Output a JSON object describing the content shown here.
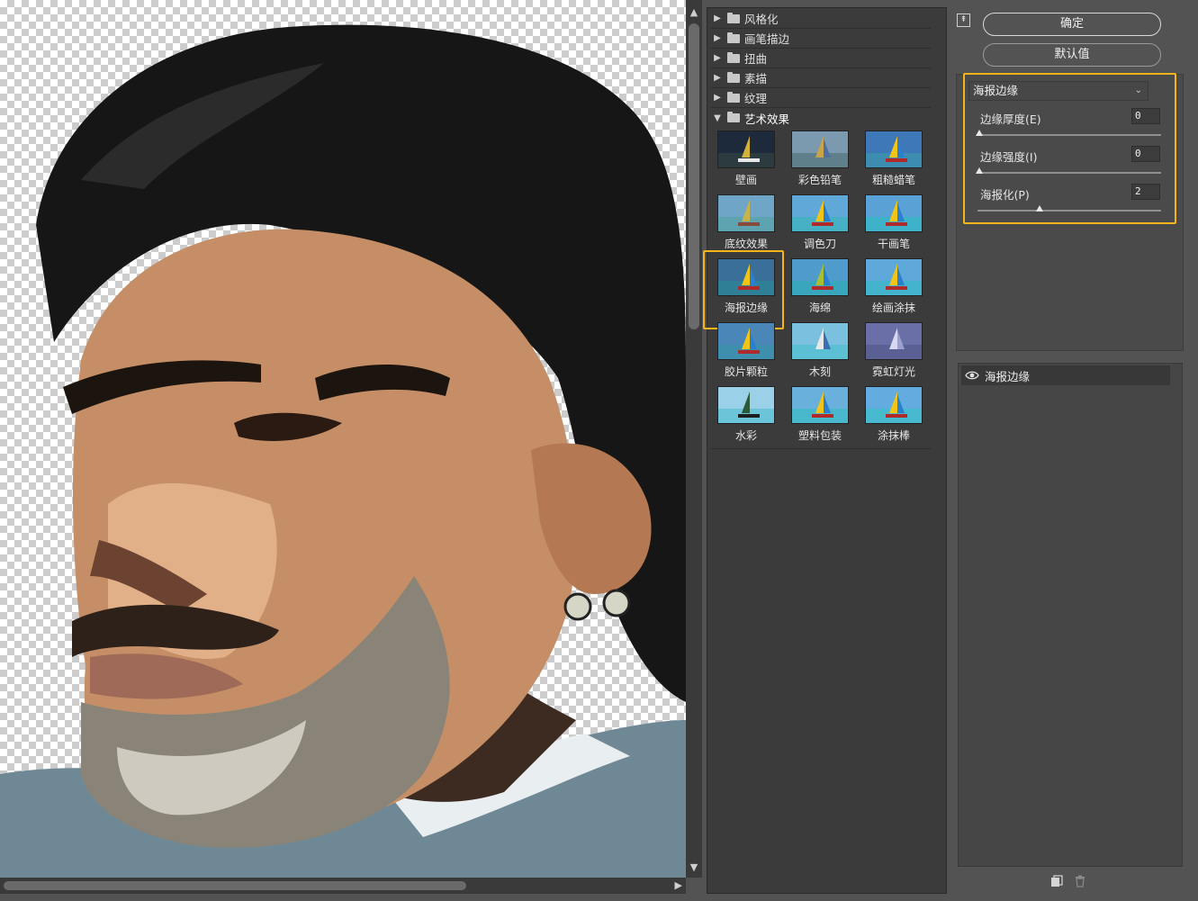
{
  "gallery": {
    "categories": [
      {
        "label": "风格化",
        "open": false
      },
      {
        "label": "画笔描边",
        "open": false
      },
      {
        "label": "扭曲",
        "open": false
      },
      {
        "label": "素描",
        "open": false
      },
      {
        "label": "纹理",
        "open": false
      },
      {
        "label": "艺术效果",
        "open": true
      }
    ],
    "filters": [
      {
        "label": "壁画"
      },
      {
        "label": "彩色铅笔"
      },
      {
        "label": "粗糙蜡笔"
      },
      {
        "label": "底纹效果"
      },
      {
        "label": "调色刀"
      },
      {
        "label": "干画笔"
      },
      {
        "label": "海报边缘",
        "selected": true
      },
      {
        "label": "海绵"
      },
      {
        "label": "绘画涂抹"
      },
      {
        "label": "胶片颗粒"
      },
      {
        "label": "木刻"
      },
      {
        "label": "霓虹灯光"
      },
      {
        "label": "水彩"
      },
      {
        "label": "塑料包装"
      },
      {
        "label": "涂抹棒"
      }
    ]
  },
  "buttons": {
    "ok": "确定",
    "defaults": "默认值"
  },
  "settings": {
    "filter_select": "海报边缘",
    "params": [
      {
        "label": "边缘厚度(E)",
        "value": "0",
        "level": 0
      },
      {
        "label": "边缘强度(I)",
        "value": "0",
        "level": 0
      },
      {
        "label": "海报化(P)",
        "value": "2",
        "level": 0.33
      }
    ]
  },
  "layers": {
    "items": [
      {
        "label": "海报边缘",
        "visible": true
      }
    ]
  },
  "colors": {
    "accent_highlight": "#f4b41a",
    "panel_bg": "#535353",
    "gallery_bg": "#3b3b3b"
  },
  "icons": [
    "collapse-icon",
    "folder-icon",
    "triangle-icon",
    "eye-icon",
    "new-layer-icon",
    "trash-icon",
    "chevron-down-icon"
  ]
}
